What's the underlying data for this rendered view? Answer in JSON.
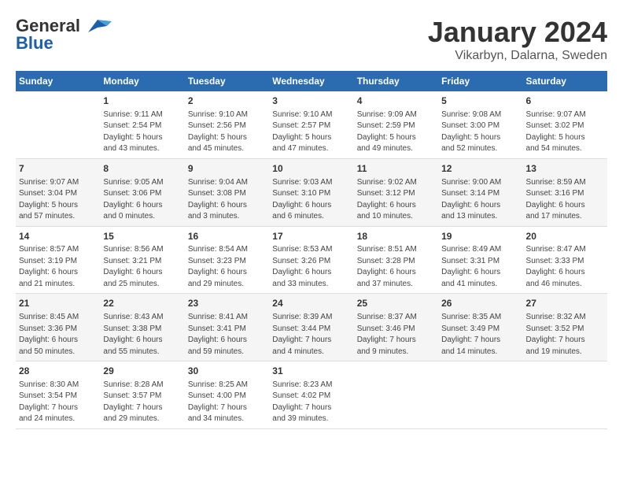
{
  "header": {
    "logo_general": "General",
    "logo_blue": "Blue",
    "month": "January 2024",
    "location": "Vikarbyn, Dalarna, Sweden"
  },
  "days_of_week": [
    "Sunday",
    "Monday",
    "Tuesday",
    "Wednesday",
    "Thursday",
    "Friday",
    "Saturday"
  ],
  "weeks": [
    [
      {
        "day": "",
        "info": ""
      },
      {
        "day": "1",
        "info": "Sunrise: 9:11 AM\nSunset: 2:54 PM\nDaylight: 5 hours\nand 43 minutes."
      },
      {
        "day": "2",
        "info": "Sunrise: 9:10 AM\nSunset: 2:56 PM\nDaylight: 5 hours\nand 45 minutes."
      },
      {
        "day": "3",
        "info": "Sunrise: 9:10 AM\nSunset: 2:57 PM\nDaylight: 5 hours\nand 47 minutes."
      },
      {
        "day": "4",
        "info": "Sunrise: 9:09 AM\nSunset: 2:59 PM\nDaylight: 5 hours\nand 49 minutes."
      },
      {
        "day": "5",
        "info": "Sunrise: 9:08 AM\nSunset: 3:00 PM\nDaylight: 5 hours\nand 52 minutes."
      },
      {
        "day": "6",
        "info": "Sunrise: 9:07 AM\nSunset: 3:02 PM\nDaylight: 5 hours\nand 54 minutes."
      }
    ],
    [
      {
        "day": "7",
        "info": "Sunrise: 9:07 AM\nSunset: 3:04 PM\nDaylight: 5 hours\nand 57 minutes."
      },
      {
        "day": "8",
        "info": "Sunrise: 9:05 AM\nSunset: 3:06 PM\nDaylight: 6 hours\nand 0 minutes."
      },
      {
        "day": "9",
        "info": "Sunrise: 9:04 AM\nSunset: 3:08 PM\nDaylight: 6 hours\nand 3 minutes."
      },
      {
        "day": "10",
        "info": "Sunrise: 9:03 AM\nSunset: 3:10 PM\nDaylight: 6 hours\nand 6 minutes."
      },
      {
        "day": "11",
        "info": "Sunrise: 9:02 AM\nSunset: 3:12 PM\nDaylight: 6 hours\nand 10 minutes."
      },
      {
        "day": "12",
        "info": "Sunrise: 9:00 AM\nSunset: 3:14 PM\nDaylight: 6 hours\nand 13 minutes."
      },
      {
        "day": "13",
        "info": "Sunrise: 8:59 AM\nSunset: 3:16 PM\nDaylight: 6 hours\nand 17 minutes."
      }
    ],
    [
      {
        "day": "14",
        "info": "Sunrise: 8:57 AM\nSunset: 3:19 PM\nDaylight: 6 hours\nand 21 minutes."
      },
      {
        "day": "15",
        "info": "Sunrise: 8:56 AM\nSunset: 3:21 PM\nDaylight: 6 hours\nand 25 minutes."
      },
      {
        "day": "16",
        "info": "Sunrise: 8:54 AM\nSunset: 3:23 PM\nDaylight: 6 hours\nand 29 minutes."
      },
      {
        "day": "17",
        "info": "Sunrise: 8:53 AM\nSunset: 3:26 PM\nDaylight: 6 hours\nand 33 minutes."
      },
      {
        "day": "18",
        "info": "Sunrise: 8:51 AM\nSunset: 3:28 PM\nDaylight: 6 hours\nand 37 minutes."
      },
      {
        "day": "19",
        "info": "Sunrise: 8:49 AM\nSunset: 3:31 PM\nDaylight: 6 hours\nand 41 minutes."
      },
      {
        "day": "20",
        "info": "Sunrise: 8:47 AM\nSunset: 3:33 PM\nDaylight: 6 hours\nand 46 minutes."
      }
    ],
    [
      {
        "day": "21",
        "info": "Sunrise: 8:45 AM\nSunset: 3:36 PM\nDaylight: 6 hours\nand 50 minutes."
      },
      {
        "day": "22",
        "info": "Sunrise: 8:43 AM\nSunset: 3:38 PM\nDaylight: 6 hours\nand 55 minutes."
      },
      {
        "day": "23",
        "info": "Sunrise: 8:41 AM\nSunset: 3:41 PM\nDaylight: 6 hours\nand 59 minutes."
      },
      {
        "day": "24",
        "info": "Sunrise: 8:39 AM\nSunset: 3:44 PM\nDaylight: 7 hours\nand 4 minutes."
      },
      {
        "day": "25",
        "info": "Sunrise: 8:37 AM\nSunset: 3:46 PM\nDaylight: 7 hours\nand 9 minutes."
      },
      {
        "day": "26",
        "info": "Sunrise: 8:35 AM\nSunset: 3:49 PM\nDaylight: 7 hours\nand 14 minutes."
      },
      {
        "day": "27",
        "info": "Sunrise: 8:32 AM\nSunset: 3:52 PM\nDaylight: 7 hours\nand 19 minutes."
      }
    ],
    [
      {
        "day": "28",
        "info": "Sunrise: 8:30 AM\nSunset: 3:54 PM\nDaylight: 7 hours\nand 24 minutes."
      },
      {
        "day": "29",
        "info": "Sunrise: 8:28 AM\nSunset: 3:57 PM\nDaylight: 7 hours\nand 29 minutes."
      },
      {
        "day": "30",
        "info": "Sunrise: 8:25 AM\nSunset: 4:00 PM\nDaylight: 7 hours\nand 34 minutes."
      },
      {
        "day": "31",
        "info": "Sunrise: 8:23 AM\nSunset: 4:02 PM\nDaylight: 7 hours\nand 39 minutes."
      },
      {
        "day": "",
        "info": ""
      },
      {
        "day": "",
        "info": ""
      },
      {
        "day": "",
        "info": ""
      }
    ]
  ]
}
